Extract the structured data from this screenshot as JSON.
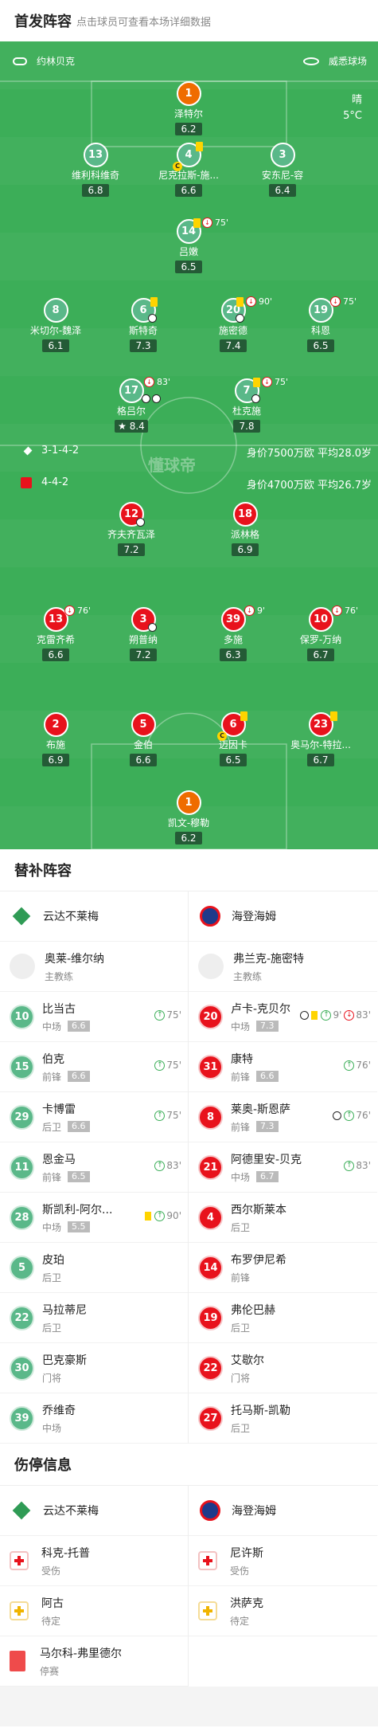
{
  "header": {
    "title": "首发阵容",
    "subtitle": "点击球员可查看本场详细数据"
  },
  "pitch": {
    "home_team": "约林贝克",
    "stadium": "威悉球场",
    "weather": "晴",
    "temp": "5°C",
    "watermark": "懂球帝",
    "home_formation": "3-1-4-2",
    "home_value": "身价7500万欧 平均28.0岁",
    "away_formation": "4-4-2",
    "away_value": "身价4700万欧 平均26.7岁"
  },
  "home_players": [
    {
      "num": "1",
      "name": "泽特尔",
      "rating": "6.2"
    },
    {
      "num": "13",
      "name": "维利科维奇",
      "rating": "6.8"
    },
    {
      "num": "4",
      "name": "尼克拉斯-施...",
      "rating": "6.6"
    },
    {
      "num": "3",
      "name": "安东尼-容",
      "rating": "6.4"
    },
    {
      "num": "14",
      "name": "吕嫩",
      "rating": "6.5",
      "sub_min": "75'"
    },
    {
      "num": "8",
      "name": "米切尔-魏泽",
      "rating": "6.1"
    },
    {
      "num": "6",
      "name": "斯特奇",
      "rating": "7.3"
    },
    {
      "num": "20",
      "name": "施密德",
      "rating": "7.4",
      "sub_min": "90'"
    },
    {
      "num": "19",
      "name": "科恩",
      "rating": "6.5",
      "sub_min": "75'"
    },
    {
      "num": "17",
      "name": "格吕尔",
      "rating": "8.4",
      "sub_min": "83'"
    },
    {
      "num": "7",
      "name": "杜克施",
      "rating": "7.8",
      "sub_min": "75'"
    }
  ],
  "away_players": [
    {
      "num": "12",
      "name": "齐夫齐瓦泽",
      "rating": "7.2"
    },
    {
      "num": "18",
      "name": "派林格",
      "rating": "6.9"
    },
    {
      "num": "13",
      "name": "克雷齐希",
      "rating": "6.6",
      "sub_min": "76'"
    },
    {
      "num": "3",
      "name": "朔普纳",
      "rating": "7.2"
    },
    {
      "num": "39",
      "name": "多施",
      "rating": "6.3",
      "sub_min": "9'"
    },
    {
      "num": "10",
      "name": "保罗-万纳",
      "rating": "6.7",
      "sub_min": "76'"
    },
    {
      "num": "2",
      "name": "布施",
      "rating": "6.9"
    },
    {
      "num": "5",
      "name": "金伯",
      "rating": "6.6"
    },
    {
      "num": "6",
      "name": "迈因卡",
      "rating": "6.5"
    },
    {
      "num": "23",
      "name": "奥马尔-特拉...",
      "rating": "6.7"
    },
    {
      "num": "1",
      "name": "凯文-穆勒",
      "rating": "6.2"
    }
  ],
  "subs": {
    "title": "替补阵容",
    "home_team": "云达不莱梅",
    "away_team": "海登海姆",
    "home_coach": {
      "name": "奥莱-维尔纳",
      "role": "主教练"
    },
    "away_coach": {
      "name": "弗兰克-施密特",
      "role": "主教练"
    },
    "home": [
      {
        "num": "10",
        "name": "比当古",
        "pos": "中场",
        "rating": "6.6",
        "min": "75'"
      },
      {
        "num": "15",
        "name": "伯克",
        "pos": "前锋",
        "rating": "6.6",
        "min": "75'"
      },
      {
        "num": "29",
        "name": "卡博雷",
        "pos": "后卫",
        "rating": "6.6",
        "min": "75'"
      },
      {
        "num": "11",
        "name": "恩金马",
        "pos": "前锋",
        "rating": "6.5",
        "min": "83'"
      },
      {
        "num": "28",
        "name": "斯凯利-阿尔...",
        "pos": "中场",
        "rating": "5.5",
        "min": "90'"
      },
      {
        "num": "5",
        "name": "皮珀",
        "pos": "后卫"
      },
      {
        "num": "22",
        "name": "马拉蒂尼",
        "pos": "后卫"
      },
      {
        "num": "30",
        "name": "巴克豪斯",
        "pos": "门将"
      },
      {
        "num": "39",
        "name": "乔维奇",
        "pos": "中场"
      }
    ],
    "away": [
      {
        "num": "20",
        "name": "卢卡-克贝尔",
        "pos": "中场",
        "rating": "7.3",
        "min": "9'",
        "min2": "83'"
      },
      {
        "num": "31",
        "name": "康特",
        "pos": "前锋",
        "rating": "6.6",
        "min": "76'"
      },
      {
        "num": "8",
        "name": "莱奥-斯恩萨",
        "pos": "前锋",
        "rating": "7.3",
        "min": "76'"
      },
      {
        "num": "21",
        "name": "阿德里安-贝克",
        "pos": "中场",
        "rating": "6.7",
        "min": "83'"
      },
      {
        "num": "4",
        "name": "西尔斯莱本",
        "pos": "后卫"
      },
      {
        "num": "14",
        "name": "布罗伊尼希",
        "pos": "前锋"
      },
      {
        "num": "19",
        "name": "弗伦巴赫",
        "pos": "后卫"
      },
      {
        "num": "22",
        "name": "艾歇尔",
        "pos": "门将"
      },
      {
        "num": "27",
        "name": "托马斯-凯勒",
        "pos": "后卫"
      }
    ]
  },
  "injuries": {
    "title": "伤停信息",
    "home_team": "云达不莱梅",
    "away_team": "海登海姆",
    "home": [
      {
        "name": "科克-托普",
        "status": "受伤"
      },
      {
        "name": "阿古",
        "status": "待定"
      },
      {
        "name": "马尔科-弗里德尔",
        "status": "停赛"
      }
    ],
    "away": [
      {
        "name": "尼许斯",
        "status": "受伤"
      },
      {
        "name": "洪萨克",
        "status": "待定"
      }
    ]
  }
}
